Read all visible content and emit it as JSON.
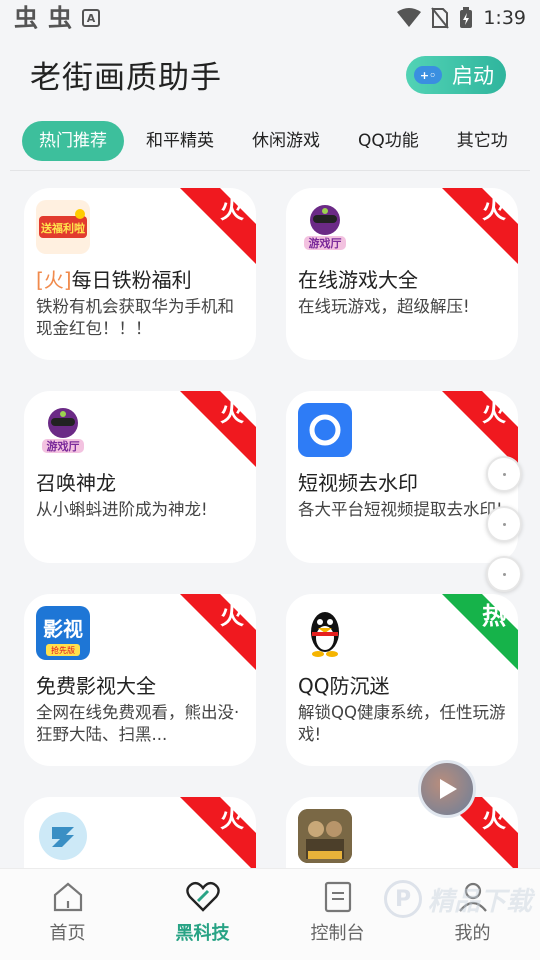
{
  "status_bar": {
    "left_icons": [
      "bug-icon",
      "bug-icon",
      "a-icon"
    ],
    "time": "1:39"
  },
  "header": {
    "title": "老街画质助手",
    "launch_label": "启动"
  },
  "tabs": [
    "热门推荐",
    "和平精英",
    "休闲游戏",
    "QQ功能",
    "其它功"
  ],
  "cards": [
    {
      "tag": "[火]",
      "title": "每日铁粉福利",
      "desc": "铁粉有机会获取华为手机和现金红包！！！",
      "badge": "火",
      "icon": "gift-logo-icon"
    },
    {
      "tag": "",
      "title": "在线游戏大全",
      "desc": "在线玩游戏，超级解压!",
      "badge": "火",
      "icon": "game-mascot-icon"
    },
    {
      "tag": "",
      "title": "召唤神龙",
      "desc": "从小蝌蚪进阶成为神龙!",
      "badge": "火",
      "icon": "game-mascot-icon"
    },
    {
      "tag": "",
      "title": "短视频去水印",
      "desc": "各大平台短视频提取去水印!",
      "badge": "火",
      "icon": "camera-icon"
    },
    {
      "tag": "",
      "title": "免费影视大全",
      "desc": "全网在线免费观看，熊出没·狂野大陆、扫黑...",
      "badge": "火",
      "icon": "video-app-icon"
    },
    {
      "tag": "",
      "title": "QQ防沉迷",
      "desc": "解锁QQ健康系统，任性玩游戏!",
      "badge": "热",
      "icon": "penguin-icon"
    },
    {
      "tag": "",
      "title": "",
      "desc": "",
      "badge": "火",
      "icon": "round-logo-icon"
    },
    {
      "tag": "",
      "title": "",
      "desc": "",
      "badge": "火",
      "icon": "game-poster-icon"
    }
  ],
  "icon_texts": {
    "gift_logo": "送福利啦",
    "game_mascot": "游戏厅",
    "video_app": "影视",
    "video_app_sub": "抢先版"
  },
  "badge_colors": {
    "fire": "#f0191f",
    "hot": "#16b34a"
  },
  "bottom_nav": [
    {
      "label": "首页",
      "icon": "home-icon",
      "active": false
    },
    {
      "label": "黑科技",
      "icon": "heart-icon",
      "active": true
    },
    {
      "label": "控制台",
      "icon": "document-icon",
      "active": false
    },
    {
      "label": "我的",
      "icon": "user-icon",
      "active": false
    }
  ],
  "watermark": "精品下载",
  "accent": "#3dbf9c"
}
